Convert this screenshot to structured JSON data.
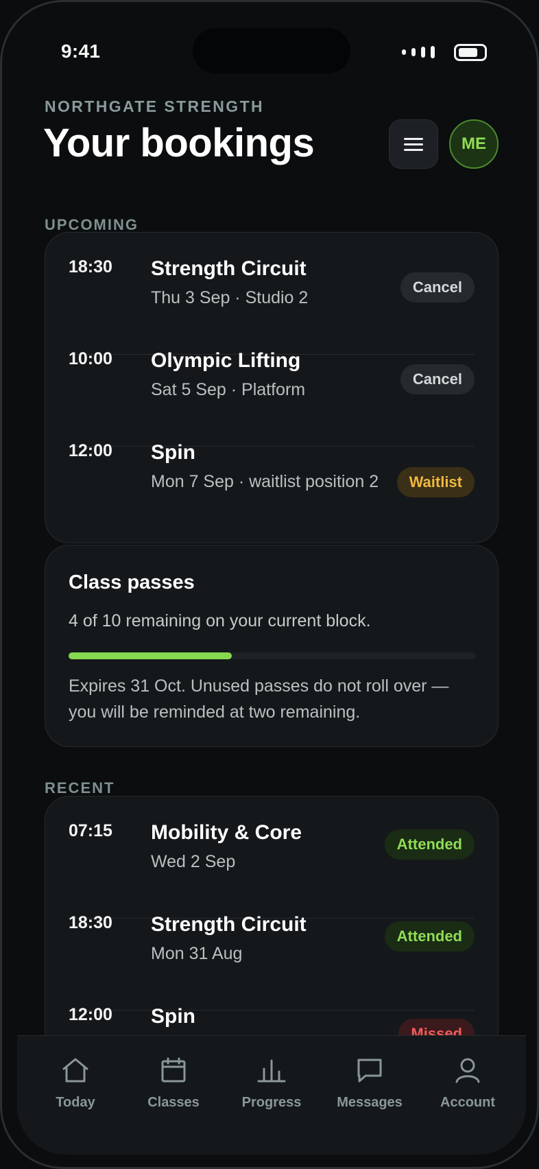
{
  "status_bar": {
    "time": "9:41"
  },
  "header": {
    "brand": "NORTHGATE STRENGTH",
    "title": "Your bookings",
    "avatar_initials": "ME"
  },
  "upcoming": {
    "label": "UPCOMING",
    "items": [
      {
        "time": "18:30",
        "name": "Strength Circuit",
        "detail": "Thu 3 Sep · Studio 2",
        "action": "Cancel"
      },
      {
        "time": "10:00",
        "name": "Olympic Lifting",
        "detail": "Sat 5 Sep · Platform",
        "action": "Cancel"
      },
      {
        "time": "12:00",
        "name": "Spin",
        "detail": "Mon 7 Sep · waitlist position 2",
        "action": "Waitlist"
      }
    ]
  },
  "passes": {
    "title": "Class passes",
    "summary": "4 of 10 remaining on your current block.",
    "remaining": 4,
    "total": 10,
    "note": "Expires 31 Oct. Unused passes do not roll over — you will be reminded at two remaining."
  },
  "recent": {
    "label": "RECENT",
    "items": [
      {
        "time": "07:15",
        "name": "Mobility & Core",
        "detail": "Wed 2 Sep",
        "status": "Attended"
      },
      {
        "time": "18:30",
        "name": "Strength Circuit",
        "detail": "Mon 31 Aug",
        "status": "Attended"
      },
      {
        "time": "12:00",
        "name": "Spin",
        "detail": "",
        "status": "Missed"
      }
    ]
  },
  "tabbar": {
    "items": [
      {
        "label": "Today",
        "icon": "home-icon"
      },
      {
        "label": "Classes",
        "icon": "calendar-icon"
      },
      {
        "label": "Progress",
        "icon": "bar-chart-icon"
      },
      {
        "label": "Messages",
        "icon": "message-icon"
      },
      {
        "label": "Account",
        "icon": "user-icon"
      }
    ]
  },
  "colors": {
    "accent": "#86d84f",
    "waitlist": "#f0b840",
    "missed": "#f05a5a",
    "background": "#0b0d0f",
    "card": "#15181b"
  }
}
